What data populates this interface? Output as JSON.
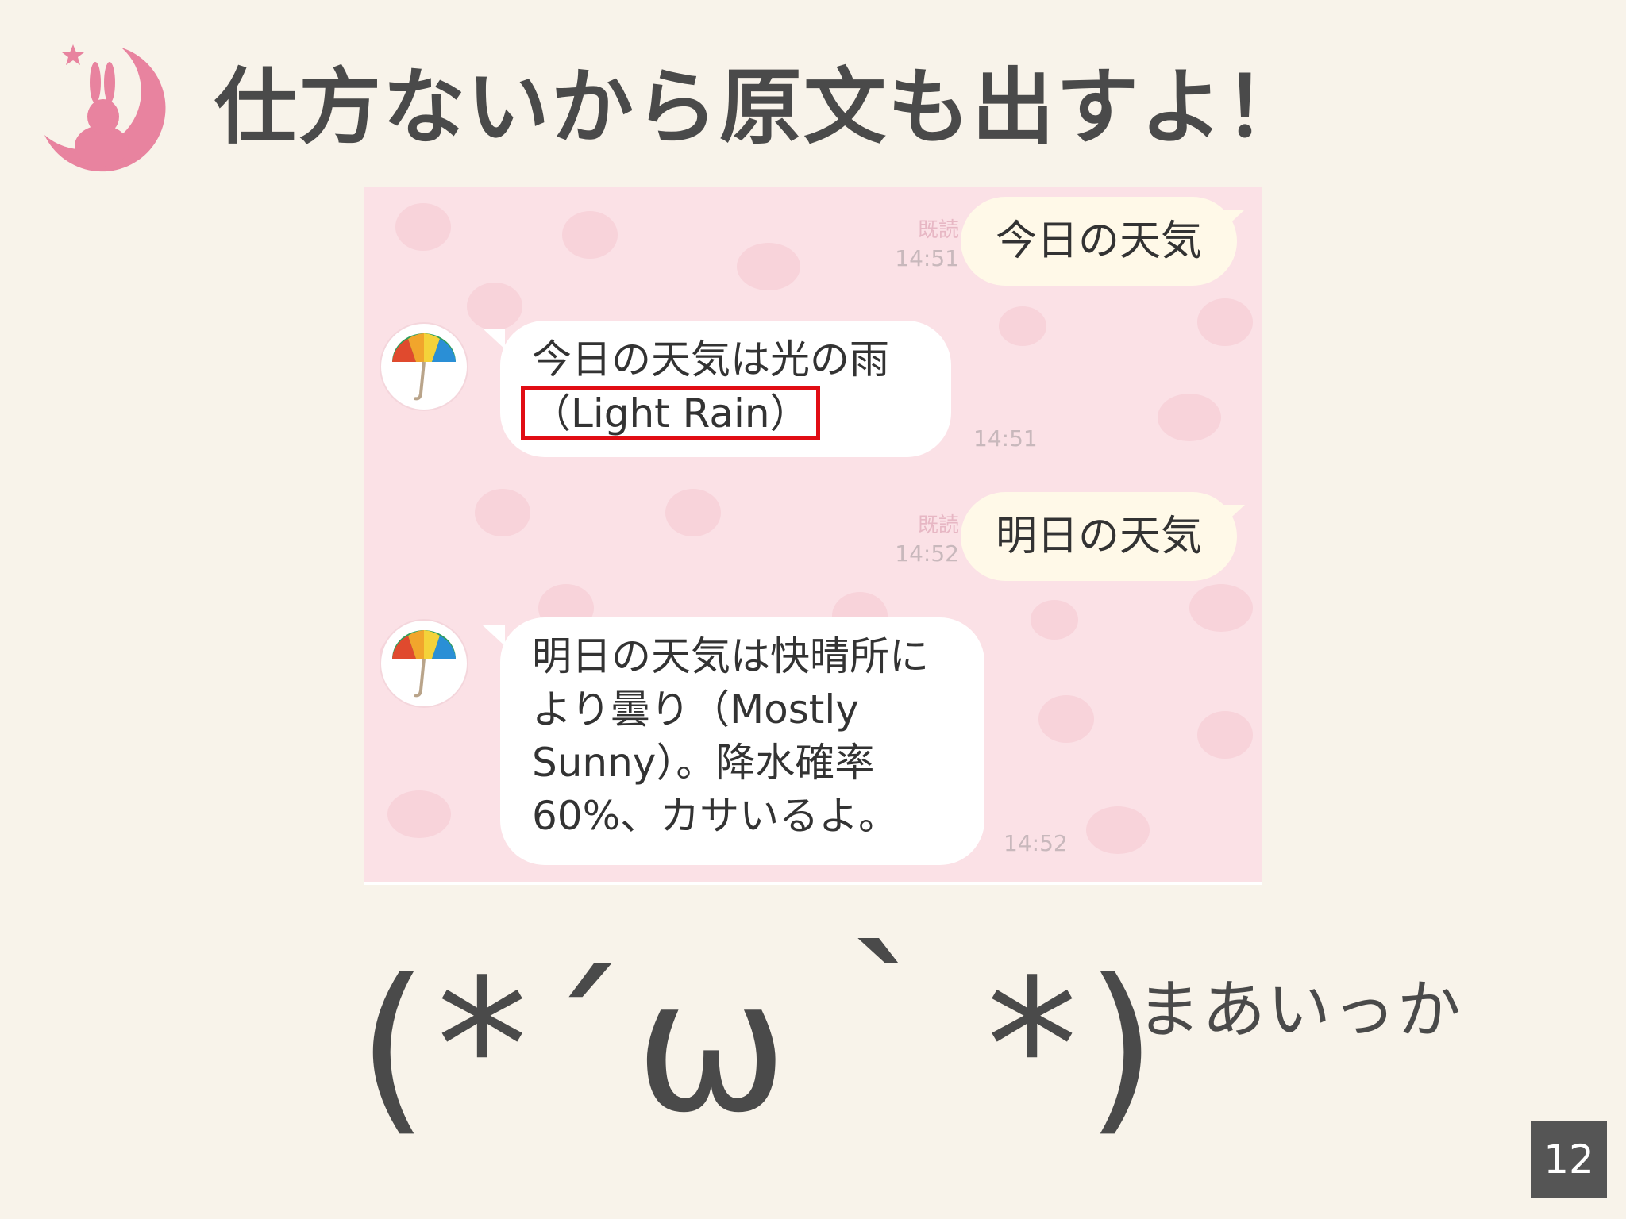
{
  "header": {
    "title": "仕方ないから原文も出すよ！"
  },
  "chat": {
    "messages": [
      {
        "sender": "user",
        "text": "今日の天気",
        "read": "既読",
        "time": "14:51"
      },
      {
        "sender": "bot",
        "line1": "今日の天気は光の雨",
        "highlighted": "（Light Rain）",
        "time": "14:51"
      },
      {
        "sender": "user",
        "text": "明日の天気",
        "read": "既読",
        "time": "14:52"
      },
      {
        "sender": "bot",
        "lines": [
          "明日の天気は快晴所に",
          "より曇り（Mostly",
          "Sunny）。降水確率",
          "60%、カサいるよ。"
        ],
        "time": "14:52"
      }
    ]
  },
  "footer": {
    "kaomoji": "(*´ω｀*)",
    "caption": "まあいっか",
    "page_number": "12"
  },
  "colors": {
    "accent_pink": "#e8839f",
    "chat_background": "#fbe1e6",
    "user_bubble": "#fff9e8",
    "highlight_border": "#e10d14"
  },
  "icons": {
    "logo": "rabbit-moon-logo-icon",
    "avatar": "umbrella-icon"
  }
}
